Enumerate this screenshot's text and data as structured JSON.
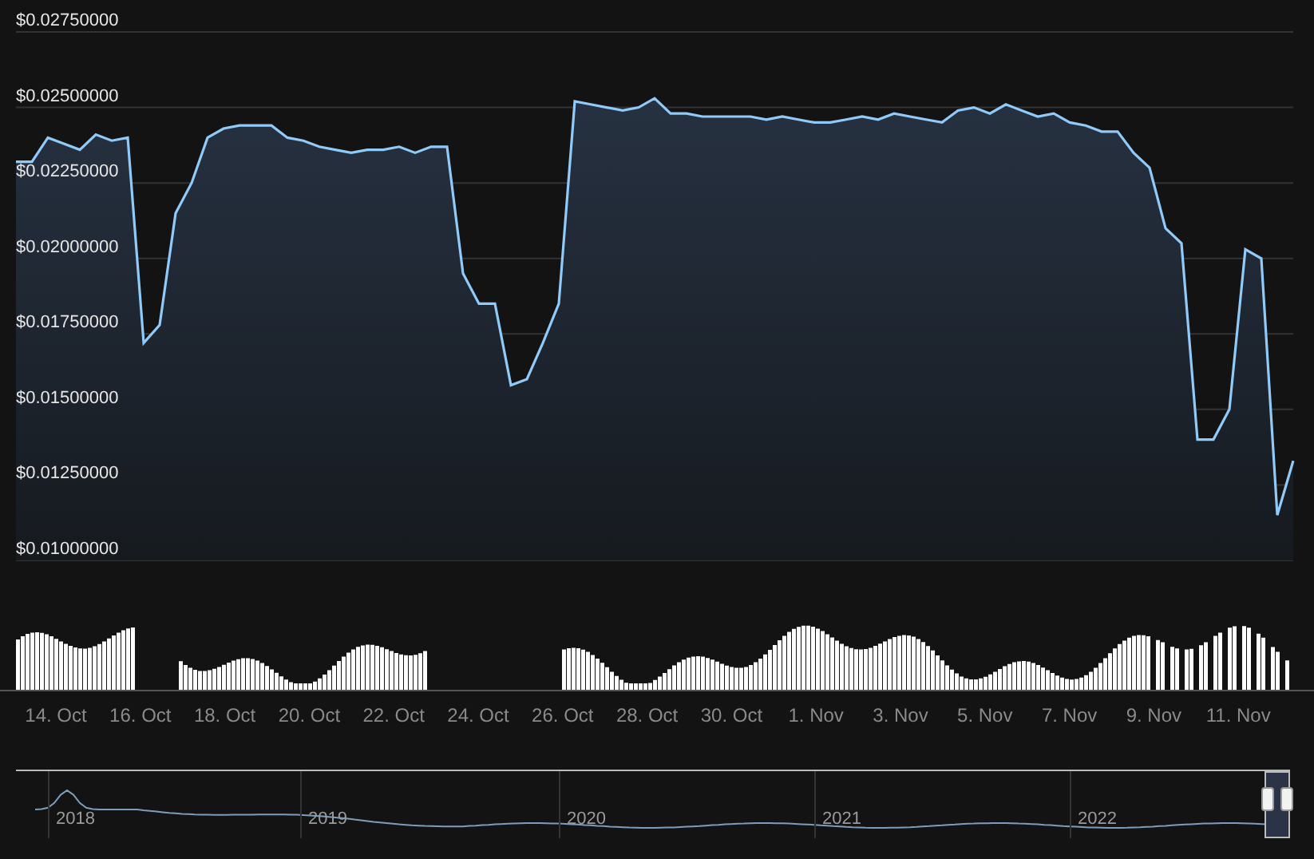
{
  "price_chart": {
    "chart_data": {
      "type": "area",
      "grid": true,
      "ylim": [
        0.01,
        0.0275
      ],
      "yticks": [
        {
          "value": 0.01,
          "label": "$0.01000000"
        },
        {
          "value": 0.0125,
          "label": "$0.01250000"
        },
        {
          "value": 0.015,
          "label": "$0.01500000"
        },
        {
          "value": 0.0175,
          "label": "$0.01750000"
        },
        {
          "value": 0.02,
          "label": "$0.02000000"
        },
        {
          "value": 0.0225,
          "label": "$0.02250000"
        },
        {
          "value": 0.025,
          "label": "$0.02500000"
        },
        {
          "value": 0.0275,
          "label": "$0.02750000"
        }
      ],
      "series": [
        {
          "color": "#90caf9",
          "values": [
            0.0232,
            0.0232,
            0.024,
            0.0238,
            0.0236,
            0.0241,
            0.0239,
            0.024,
            0.0172,
            0.0178,
            0.0215,
            0.0225,
            0.024,
            0.0243,
            0.0244,
            0.0244,
            0.0244,
            0.024,
            0.0239,
            0.0237,
            0.0236,
            0.0235,
            0.0236,
            0.0236,
            0.0237,
            0.0235,
            0.0237,
            0.0237,
            0.0195,
            0.0185,
            0.0185,
            0.0158,
            0.016,
            0.0172,
            0.0185,
            0.0252,
            0.0251,
            0.025,
            0.0249,
            0.025,
            0.0253,
            0.0248,
            0.0248,
            0.0247,
            0.0247,
            0.0247,
            0.0247,
            0.0246,
            0.0247,
            0.0246,
            0.0245,
            0.0245,
            0.0246,
            0.0247,
            0.0246,
            0.0248,
            0.0247,
            0.0246,
            0.0245,
            0.0249,
            0.025,
            0.0248,
            0.0251,
            0.0249,
            0.0247,
            0.0248,
            0.0245,
            0.0244,
            0.0242,
            0.0242,
            0.0235,
            0.023,
            0.021,
            0.0205,
            0.014,
            0.014,
            0.015,
            0.0203,
            0.02,
            0.0115,
            0.0133
          ]
        }
      ]
    }
  },
  "x_axis": {
    "labels": [
      "14. Oct",
      "16. Oct",
      "18. Oct",
      "20. Oct",
      "22. Oct",
      "24. Oct",
      "26. Oct",
      "28. Oct",
      "30. Oct",
      "1. Nov",
      "3. Nov",
      "5. Nov",
      "7. Nov",
      "9. Nov",
      "11. Nov"
    ]
  },
  "navigator": {
    "labels": [
      "2018",
      "2019",
      "2020",
      "2021",
      "2022"
    ]
  }
}
